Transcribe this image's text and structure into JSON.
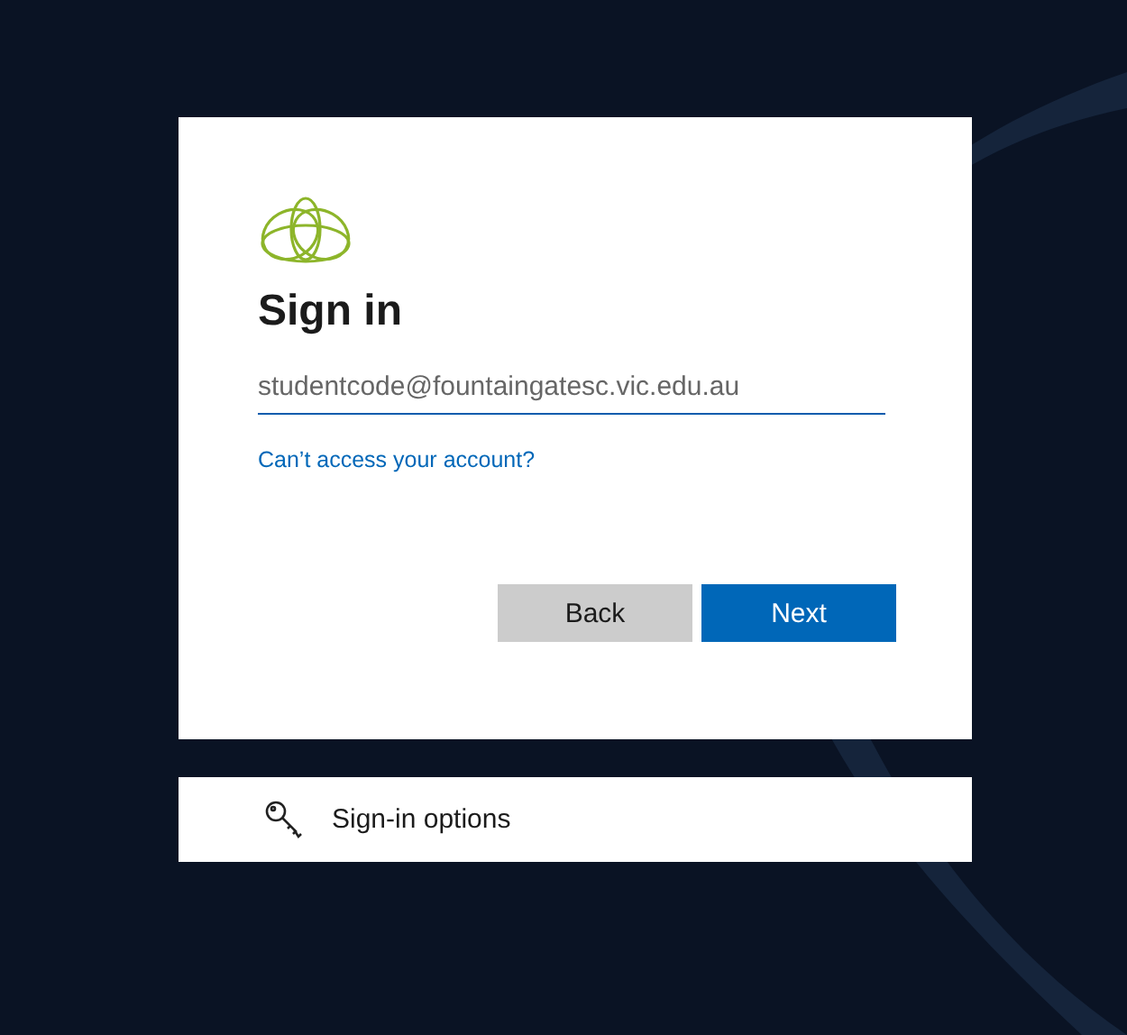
{
  "title": "Sign in",
  "email_field": {
    "placeholder": "studentcode@fountaingatesc.vic.edu.au"
  },
  "link": "Can’t access your account?",
  "buttons": [
    {
      "label": "Back",
      "kind": "secondary"
    },
    {
      "label": "Next",
      "kind": "primary"
    }
  ],
  "options": {
    "label": "Sign-in options"
  }
}
